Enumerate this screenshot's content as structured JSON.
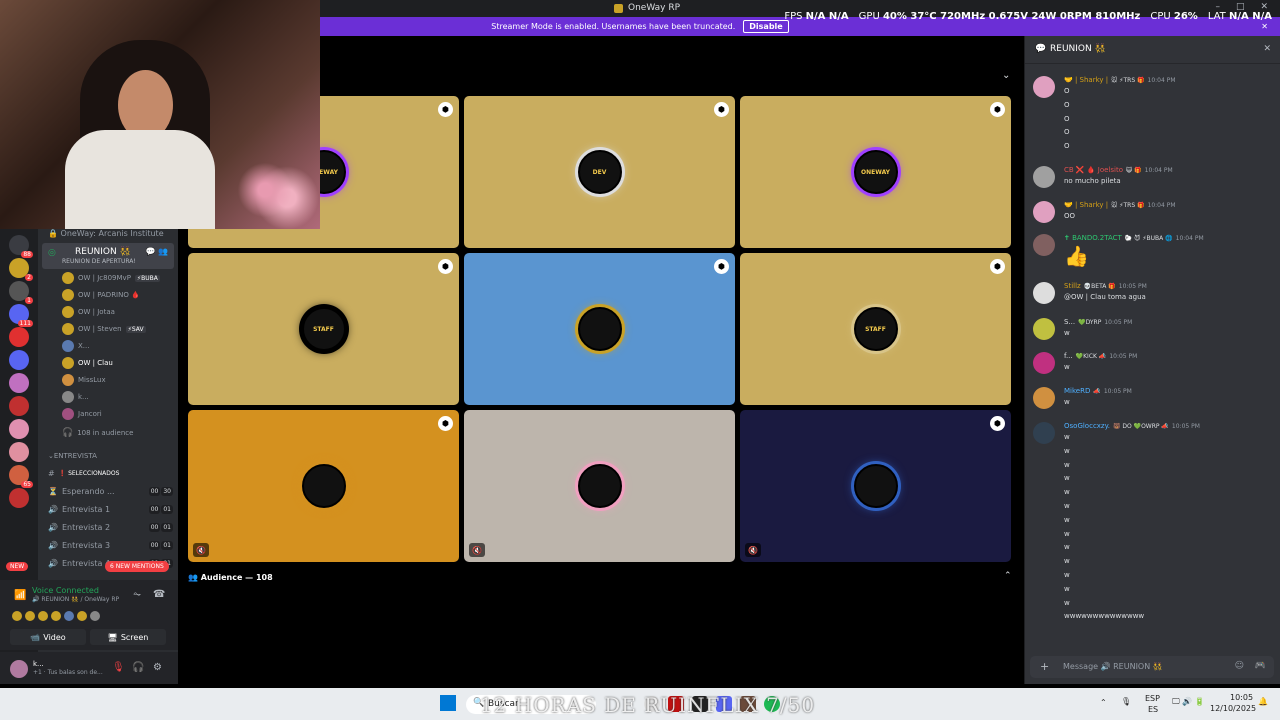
{
  "window": {
    "title": "OneWay RP",
    "controls": [
      "–",
      "□",
      "✕"
    ]
  },
  "perf": {
    "fps_label": "FPS",
    "fps": "N/A N/A",
    "gpu_label": "GPU",
    "gpu": "40% 37°C 720MHz 0.675V 24W 0RPM 810MHz",
    "cpu_label": "CPU",
    "cpu": "26%",
    "lat_label": "LAT",
    "lat": "N/A N/A"
  },
  "banner": {
    "text": "Streamer Mode is enabled. Usernames have been truncated.",
    "button": "Disable"
  },
  "servers": [
    {
      "badge": "88",
      "color": "#3a3c42"
    },
    {
      "badge": "2",
      "color": "#c9a227"
    },
    {
      "badge": "1",
      "color": "#555"
    },
    {
      "badge": "111",
      "color": "#5865f2"
    },
    {
      "badge": "",
      "color": "#e03030"
    },
    {
      "badge": "",
      "color": "#5865f2"
    },
    {
      "badge": "",
      "color": "#c070c0"
    },
    {
      "badge": "",
      "color": "#c03030"
    },
    {
      "badge": "",
      "color": "#e090b0"
    },
    {
      "badge": "",
      "color": "#e090a0"
    },
    {
      "badge": "65",
      "color": "#d06040"
    },
    {
      "badge": "",
      "color": "#c03030"
    }
  ],
  "server_new": "NEW",
  "channels": {
    "header": "OneWay: Arcanis Institute",
    "reunion": {
      "name": "REUNION 👯",
      "sub": "REUNION DE APERTURA!"
    },
    "voice_users": [
      {
        "name": "OW | Jc809MvP",
        "tag": "⚡BUBA",
        "color": "#c9a227"
      },
      {
        "name": "OW | PADRINO 🩸",
        "tag": "",
        "color": "#c9a227"
      },
      {
        "name": "OW | Jotaa",
        "tag": "",
        "color": "#c9a227"
      },
      {
        "name": "OW | Steven",
        "tag": "⚡SAV",
        "color": "#c9a227"
      },
      {
        "name": "X...",
        "tag": "",
        "color": "#5a7ab0"
      },
      {
        "name": "OW | Clau",
        "tag": "",
        "color": "#c9a227"
      },
      {
        "name": "MissLux",
        "tag": "",
        "color": "#d09040"
      },
      {
        "name": "k...",
        "tag": "",
        "color": "#888"
      },
      {
        "name": "Jancori",
        "tag": "",
        "color": "#a05080"
      }
    ],
    "audience": "108 in audience",
    "section": "ENTREVISTA",
    "rooms": [
      {
        "icon": "#",
        "name": "❗ SELECCIONADOS",
        "c1": "",
        "c2": ""
      },
      {
        "icon": "⏳",
        "name": "Esperando ...",
        "c1": "00",
        "c2": "30"
      },
      {
        "icon": "🔊",
        "name": "Entrevista 1",
        "c1": "00",
        "c2": "01"
      },
      {
        "icon": "🔊",
        "name": "Entrevista 2",
        "c1": "00",
        "c2": "01"
      },
      {
        "icon": "🔊",
        "name": "Entrevista 3",
        "c1": "00",
        "c2": "01"
      },
      {
        "icon": "🔊",
        "name": "Entrevista 4",
        "c1": "00",
        "c2": "01"
      }
    ],
    "mentions": "6 NEW MENTIONS"
  },
  "voice": {
    "status": "Voice Connected",
    "channel": "🔊 REUNION 👯 / OneWay RP",
    "video": "Video",
    "screen": "Screen"
  },
  "user": {
    "name": "k...",
    "status": "+1 · Tus balas son de..."
  },
  "stage": {
    "tiles": [
      {
        "bg": "#c9ad5f",
        "label": "ONEWAY",
        "ring": "#a040ff",
        "pin": true,
        "mute": false
      },
      {
        "bg": "#c9ad5f",
        "label": "DEV",
        "ring": "#ddd",
        "pin": true,
        "mute": false
      },
      {
        "bg": "#c9ad5f",
        "label": "ONEWAY",
        "ring": "#a040ff",
        "pin": true,
        "mute": false
      },
      {
        "bg": "#c9ad5f",
        "label": "STAFF",
        "ring": "#000",
        "pin": true,
        "mute": false
      },
      {
        "bg": "#5a95d0",
        "label": "",
        "ring": "#c9a227",
        "pin": true,
        "mute": false
      },
      {
        "bg": "#c9ad5f",
        "label": "STAFF",
        "ring": "#d8c488",
        "pin": true,
        "mute": false
      },
      {
        "bg": "#d4911f",
        "label": "",
        "ring": "#d4911f",
        "pin": true,
        "mute": true
      },
      {
        "bg": "#bdb5ac",
        "label": "",
        "ring": "#f0a0c0",
        "pin": false,
        "mute": true
      },
      {
        "bg": "#1a1a40",
        "label": "",
        "ring": "#3060c0",
        "pin": true,
        "mute": true
      }
    ],
    "audience_label": "Audience — 108"
  },
  "chat": {
    "title": "REUNION 👯",
    "messages": [
      {
        "author": "🤝 | Sharky |",
        "tags": "🐭 ⚡TRS 🎁",
        "time": "10:04 PM",
        "color": "#d4a017",
        "lines": [
          "O",
          "O",
          "O",
          "O",
          "O"
        ],
        "av": "#e0a0c0"
      },
      {
        "author": "CB ❌ 🩸 Joelsito",
        "tags": "😺 🎁",
        "time": "10:04 PM",
        "color": "#e05050",
        "lines": [
          "no mucho pileta"
        ],
        "av": "#a0a0a0"
      },
      {
        "author": "🤝 | Sharky |",
        "tags": "🐭 ⚡TRS 🎁",
        "time": "10:04 PM",
        "color": "#d4a017",
        "lines": [
          "OO"
        ],
        "av": "#e0a0c0"
      },
      {
        "author": "✝ BANDO.2TACT",
        "tags": "🐑 😈 ⚡BUBA 🌐",
        "time": "10:04 PM",
        "color": "#2dc770",
        "lines": [
          "👍"
        ],
        "av": "#806060"
      },
      {
        "author": "Stillz",
        "tags": "💀BETA 🎁",
        "time": "10:05 PM",
        "color": "#d4a017",
        "lines": [
          "@OW | Clau toma agua"
        ],
        "av": "#ddd"
      },
      {
        "author": "S...",
        "tags": "💚DYRP",
        "time": "10:05 PM",
        "color": "#dbdee1",
        "lines": [
          "w"
        ],
        "av": "#c0c040"
      },
      {
        "author": "f...",
        "tags": "💚KICK 📣",
        "time": "10:05 PM",
        "color": "#dbdee1",
        "lines": [
          "w"
        ],
        "av": "#c03080"
      },
      {
        "author": "MikeRD",
        "tags": "📣",
        "time": "10:05 PM",
        "color": "#4fb0ff",
        "lines": [
          "w"
        ],
        "av": "#d09040"
      },
      {
        "author": "OsoGloccxzy.",
        "tags": "🐻 DO 💚OWRP 📣",
        "time": "10:05 PM",
        "color": "#4fb0ff",
        "lines": [
          "w",
          "w",
          "w",
          "w",
          "w",
          "w",
          "w",
          "w",
          "w",
          "w",
          "w",
          "w",
          "w",
          "wwwwwwwwwwwwww"
        ],
        "av": "#304050"
      }
    ],
    "input_placeholder": "Message 🔊 REUNION 👯"
  },
  "taskbar": {
    "search": "Buscar",
    "overlay": "12 HORAS DE RUINFLIX 7/50",
    "lang": "ESP",
    "lang2": "ES",
    "time": "10:05",
    "date": "12/10/2025"
  }
}
